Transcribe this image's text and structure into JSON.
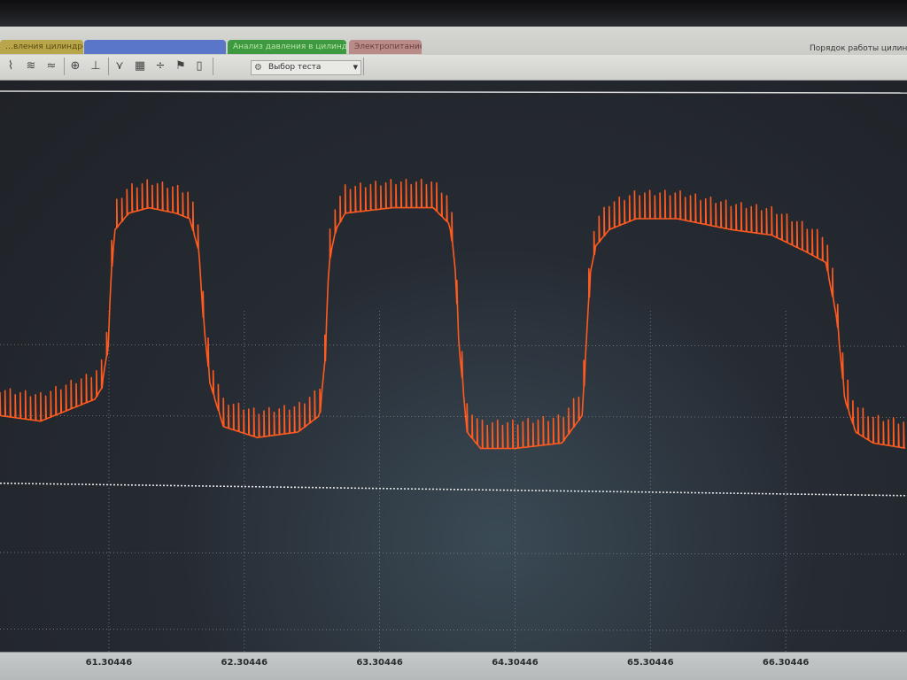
{
  "tabs": [
    {
      "label": "…вления цилиндров"
    },
    {
      "label": ""
    },
    {
      "label": "Анализ давления в цилиндре"
    },
    {
      "label": "Электропитание"
    }
  ],
  "header_right": "Порядок работы цилиндров",
  "toolbar": {
    "test_select_label": "Выбор теста",
    "icons": [
      "wave-icon",
      "multi-wave-icon",
      "multi-wave-alt-icon",
      "auto-scale-icon",
      "zero-marker-icon",
      "filter-icon",
      "table-icon",
      "divide-icon",
      "marker-flag-icon",
      "document-icon"
    ]
  },
  "colors": {
    "trace": "#ff5a1f",
    "background": "#23272d",
    "reference_line": "#e6e6e6"
  },
  "chart_data": {
    "type": "line",
    "x_ticks": [
      "61.30446",
      "62.30446",
      "63.30446",
      "64.30446",
      "65.30446",
      "66.30446"
    ],
    "xlim": [
      60.5,
      67.2
    ],
    "ylim": [
      0,
      1
    ],
    "grid": true,
    "reference_level": 0.29,
    "series": [
      {
        "x": [
          60.5,
          60.8,
          61.2,
          61.25,
          61.3,
          61.32,
          61.35,
          61.45,
          61.6,
          61.8,
          61.9,
          61.97,
          62.0,
          62.05,
          62.15,
          62.4,
          62.7,
          62.86,
          62.9,
          62.93,
          62.98,
          63.05,
          63.4,
          63.7,
          63.82,
          63.86,
          63.89,
          63.95,
          64.05,
          64.3,
          64.65,
          64.8,
          64.83,
          64.86,
          64.9,
          65.0,
          65.2,
          65.5,
          65.9,
          66.2,
          66.45,
          66.6,
          66.68,
          66.74,
          66.82,
          66.95,
          67.2
        ],
        "y": [
          0.42,
          0.41,
          0.45,
          0.47,
          0.55,
          0.68,
          0.76,
          0.79,
          0.8,
          0.79,
          0.78,
          0.72,
          0.6,
          0.48,
          0.4,
          0.38,
          0.39,
          0.42,
          0.52,
          0.7,
          0.76,
          0.79,
          0.8,
          0.8,
          0.77,
          0.7,
          0.55,
          0.39,
          0.36,
          0.36,
          0.37,
          0.42,
          0.55,
          0.68,
          0.73,
          0.76,
          0.78,
          0.78,
          0.76,
          0.75,
          0.72,
          0.7,
          0.6,
          0.45,
          0.39,
          0.37,
          0.36
        ]
      }
    ]
  }
}
